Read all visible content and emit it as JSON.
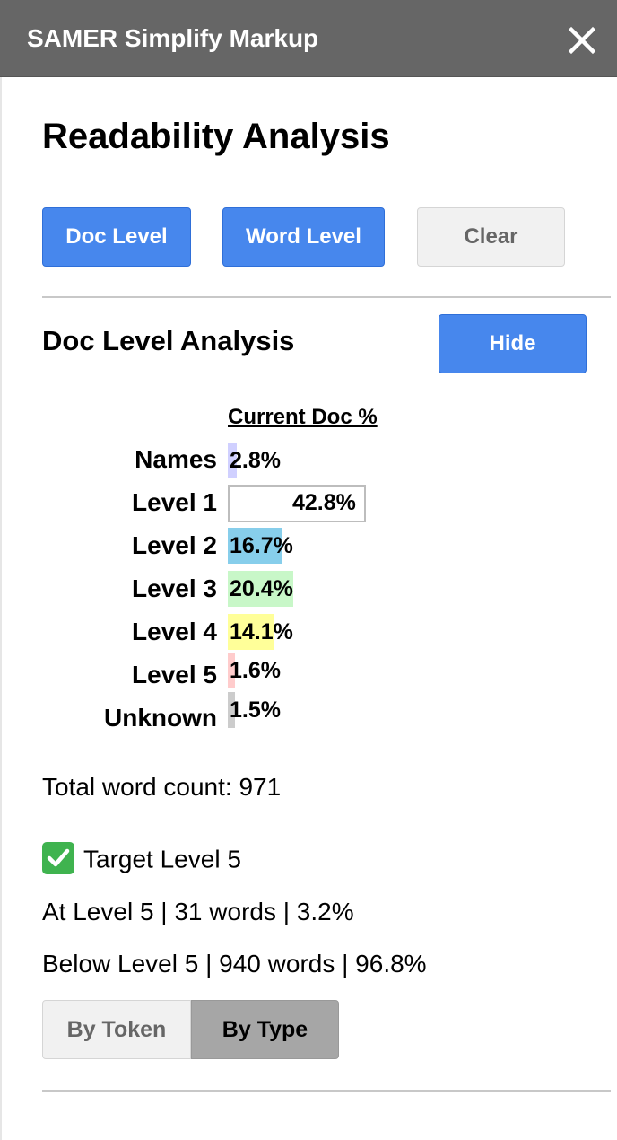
{
  "window": {
    "title": "SAMER Simplify Markup",
    "close_icon": "close-icon"
  },
  "page": {
    "heading": "Readability Analysis"
  },
  "toolbar": {
    "doc_level_label": "Doc Level",
    "word_level_label": "Word Level",
    "clear_label": "Clear"
  },
  "doc_analysis": {
    "heading": "Doc Level Analysis",
    "hide_label": "Hide",
    "column_header": "Current Doc %",
    "rows": [
      {
        "label": "Names",
        "value": "2.8%",
        "percent": 2.8,
        "color": "#d0d0ff"
      },
      {
        "label": "Level 1",
        "value": "42.8%",
        "percent": 42.8,
        "color": "#ffffff"
      },
      {
        "label": "Level 2",
        "value": "16.7%",
        "percent": 16.7,
        "color": "#87ceeb"
      },
      {
        "label": "Level 3",
        "value": "20.4%",
        "percent": 20.4,
        "color": "#c8f7c8"
      },
      {
        "label": "Level 4",
        "value": "14.1%",
        "percent": 14.1,
        "color": "#ffff99"
      },
      {
        "label": "Level 5",
        "value": "1.6%",
        "percent": 1.6,
        "color": "#ffcccc"
      },
      {
        "label": "Unknown",
        "value": "1.5%",
        "percent": 1.5,
        "color": "#cccccc"
      }
    ],
    "total_word_count": "Total word count: 971",
    "target": {
      "icon": "check-mark-icon",
      "label": "Target Level 5"
    },
    "at_level": "At Level 5 | 31 words | 3.2%",
    "below_level": "Below Level 5 | 940 words | 96.8%",
    "view_toggle": {
      "by_token_label": "By Token",
      "by_type_label": "By Type",
      "selected": "By Type"
    }
  }
}
